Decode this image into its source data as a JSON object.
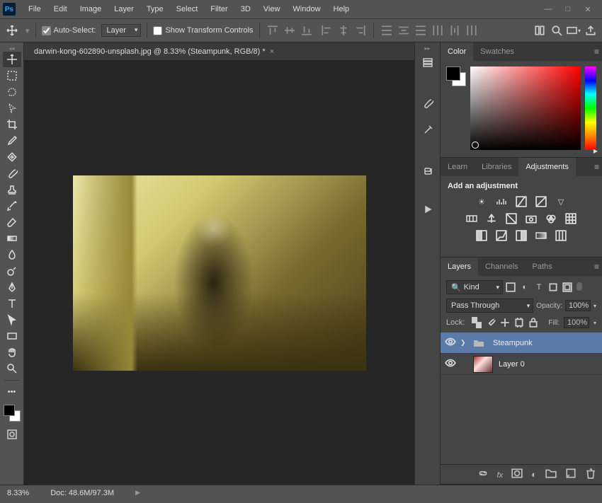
{
  "menu": {
    "items": [
      "File",
      "Edit",
      "Image",
      "Layer",
      "Type",
      "Select",
      "Filter",
      "3D",
      "View",
      "Window",
      "Help"
    ]
  },
  "options": {
    "auto_select": "Auto-Select:",
    "target": "Layer",
    "show_transform": "Show Transform Controls"
  },
  "doc": {
    "title": "darwin-kong-602890-unsplash.jpg @ 8.33% (Steampunk, RGB/8) *"
  },
  "status": {
    "zoom": "8.33%",
    "doc": "Doc: 48.6M/97.3M"
  },
  "panel_color": {
    "tabs": [
      "Color",
      "Swatches"
    ]
  },
  "panel_adj": {
    "tabs": [
      "Learn",
      "Libraries",
      "Adjustments"
    ],
    "title": "Add an adjustment"
  },
  "panel_layers": {
    "tabs": [
      "Layers",
      "Channels",
      "Paths"
    ],
    "kind": "Kind",
    "blend": "Pass Through",
    "opacity_label": "Opacity:",
    "opacity": "100%",
    "lock_label": "Lock:",
    "fill_label": "Fill:",
    "fill": "100%",
    "layers": [
      {
        "name": "Steampunk",
        "type": "group"
      },
      {
        "name": "Layer 0",
        "type": "layer"
      }
    ]
  }
}
